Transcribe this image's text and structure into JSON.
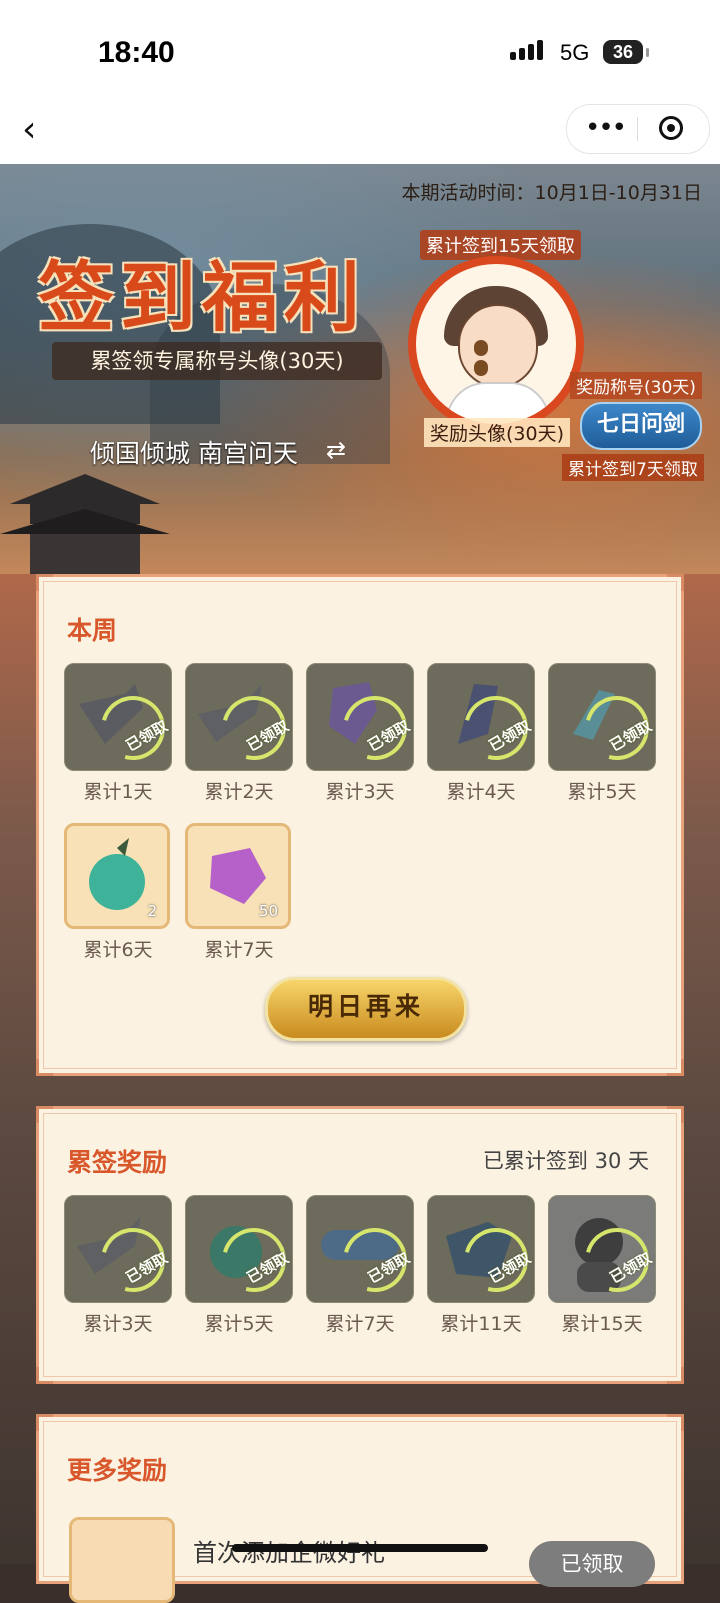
{
  "status": {
    "time": "18:40",
    "network": "5G",
    "battery": "36"
  },
  "nav": {
    "back_icon": "chevron-left-icon",
    "more_icon": "more-dots-icon",
    "close_icon": "target-circle-icon"
  },
  "banner": {
    "period": "本期活动时间：10月1日-10月31日",
    "main_title": "签到福利",
    "subtitle": "累签领专属称号头像(30天)",
    "character": "倾国倾城 南宫问天",
    "avatar_top_label": "累计签到15天领取",
    "avatar_label": "奖励头像(30天)",
    "title_label": "奖励称号(30天)",
    "title_badge": "七日问剑",
    "title_claim": "累计签到7天领取"
  },
  "week": {
    "title": "本周",
    "items": [
      {
        "day": "累计1天",
        "claimed": true,
        "stamp": "已领取"
      },
      {
        "day": "累计2天",
        "claimed": true,
        "stamp": "已领取"
      },
      {
        "day": "累计3天",
        "claimed": true,
        "stamp": "已领取"
      },
      {
        "day": "累计4天",
        "claimed": true,
        "stamp": "已领取"
      },
      {
        "day": "累计5天",
        "claimed": true,
        "stamp": "已领取"
      },
      {
        "day": "累计6天",
        "claimed": false,
        "qty": "2"
      },
      {
        "day": "累计7天",
        "claimed": false,
        "qty": "50"
      }
    ],
    "button": "明日再来"
  },
  "cumulative": {
    "title": "累签奖励",
    "summary": "已累计签到 30 天",
    "items": [
      {
        "day": "累计3天",
        "stamp": "已领取"
      },
      {
        "day": "累计5天",
        "stamp": "已领取"
      },
      {
        "day": "累计7天",
        "stamp": "已领取"
      },
      {
        "day": "累计11天",
        "stamp": "已领取"
      },
      {
        "day": "累计15天",
        "stamp": "已领取"
      }
    ]
  },
  "more": {
    "title": "更多奖励",
    "row_text": "首次添加企微好礼",
    "row_button": "已领取"
  },
  "colors": {
    "accent": "#d8572b",
    "card_bg": "#fbf2e2",
    "border": "#e7a27c",
    "gold": "#f7d56a"
  }
}
